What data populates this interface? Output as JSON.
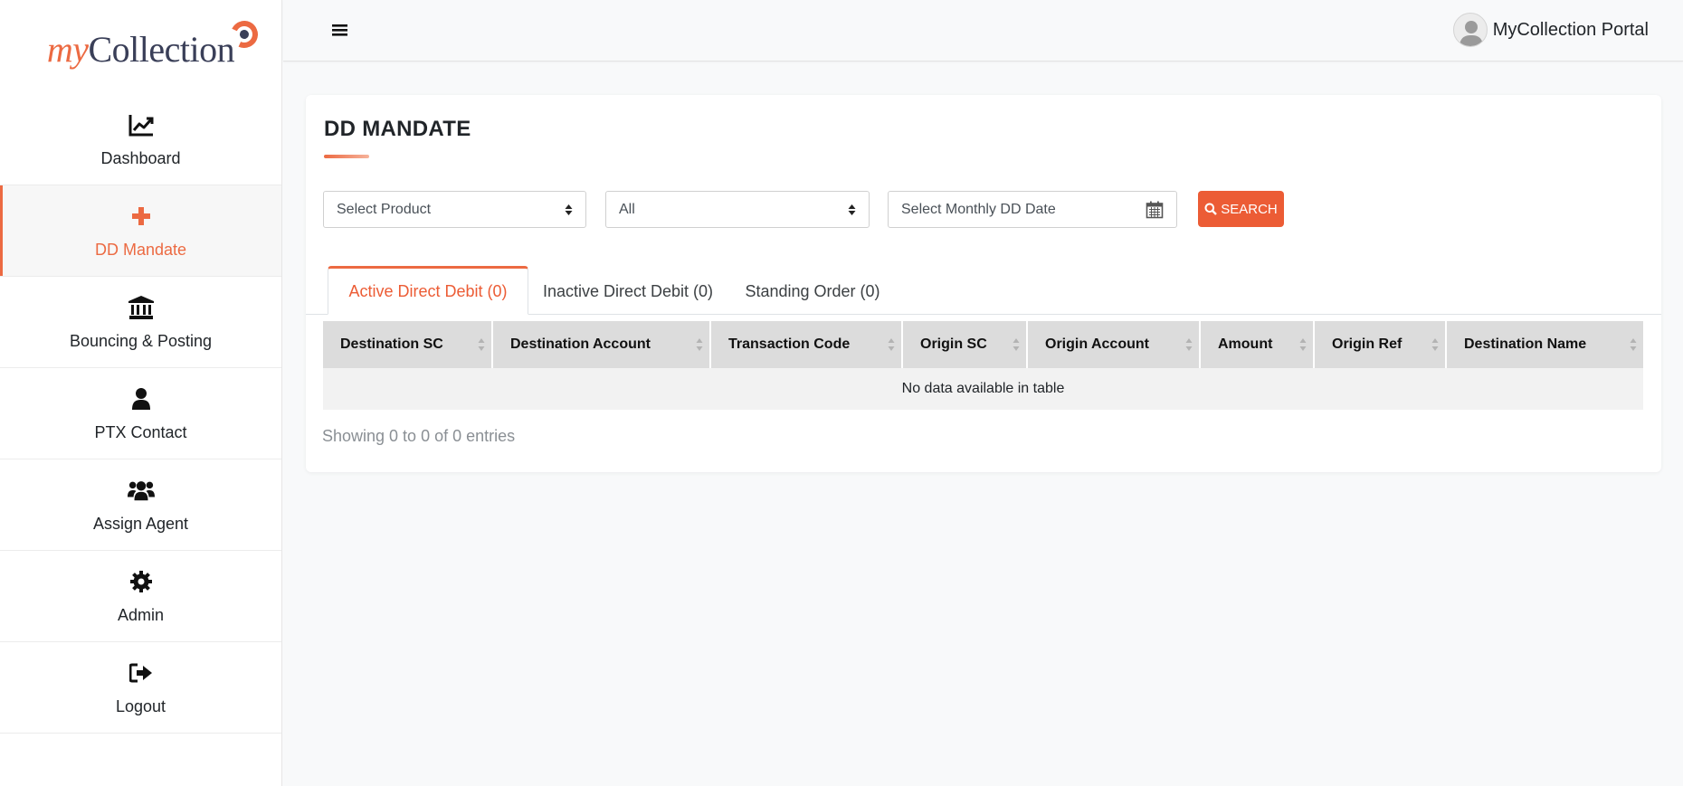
{
  "brand": {
    "logo_my": "my",
    "logo_collection": "Collection",
    "accent": "#ec6a42"
  },
  "sidebar": {
    "items": [
      {
        "label": "Dashboard",
        "icon": "chart-line-icon",
        "active": false
      },
      {
        "label": "DD Mandate",
        "icon": "plus-icon",
        "active": true
      },
      {
        "label": "Bouncing & Posting",
        "icon": "bank-icon",
        "active": false
      },
      {
        "label": "PTX Contact",
        "icon": "user-icon",
        "active": false
      },
      {
        "label": "Assign Agent",
        "icon": "users-icon",
        "active": false
      },
      {
        "label": "Admin",
        "icon": "gear-icon",
        "active": false
      },
      {
        "label": "Logout",
        "icon": "sign-out-icon",
        "active": false
      }
    ]
  },
  "header": {
    "user_name": "MyCollection Portal"
  },
  "main": {
    "title": "DD MANDATE",
    "filters": {
      "product_value": "Select Product",
      "status_value": "All",
      "date_placeholder": "Select Monthly DD Date",
      "search_label": "SEARCH"
    },
    "tabs": [
      {
        "label": "Active Direct Debit (0)",
        "active": true
      },
      {
        "label": "Inactive Direct Debit (0)",
        "active": false
      },
      {
        "label": "Standing Order (0)",
        "active": false
      }
    ],
    "table": {
      "columns": [
        "Destination SC",
        "Destination Account",
        "Transaction Code",
        "Origin SC",
        "Origin Account",
        "Amount",
        "Origin Ref",
        "Destination Name"
      ],
      "empty_message": "No data available in table"
    },
    "info": "Showing 0 to 0 of 0 entries"
  }
}
